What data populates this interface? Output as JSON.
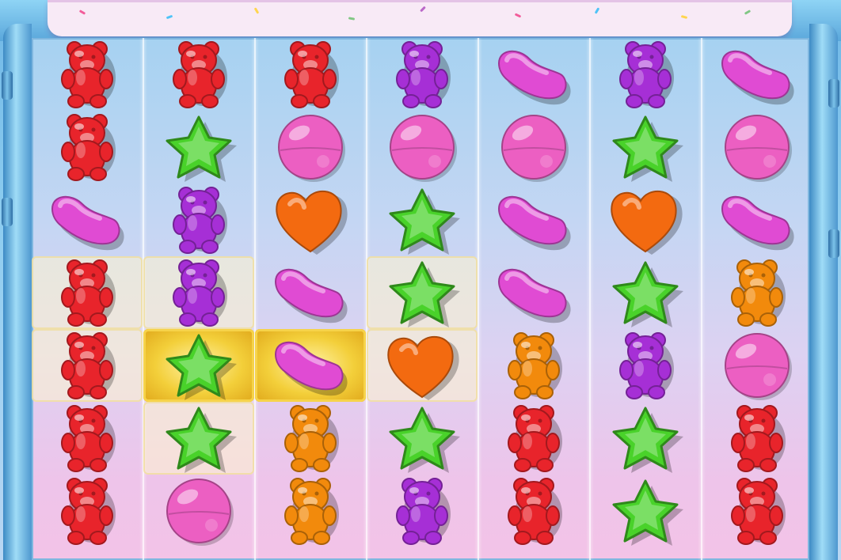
{
  "game": {
    "grid": [
      [
        "red-bear",
        "red-bear",
        "red-bear",
        "purple-bear",
        "pink-bean",
        "purple-bear",
        "pink-bean"
      ],
      [
        "red-bear",
        "green-star",
        "pink-lollipop",
        "pink-lollipop",
        "pink-lollipop",
        "green-star",
        "pink-lollipop"
      ],
      [
        "pink-bean",
        "purple-bear",
        "orange-heart",
        "green-star",
        "pink-bean",
        "orange-heart",
        "pink-bean"
      ],
      [
        "red-bear",
        "purple-bear",
        "pink-bean",
        "green-star",
        "pink-bean",
        "green-star",
        "orange-bear"
      ],
      [
        "red-bear",
        "green-star",
        "pink-bean",
        "orange-heart",
        "orange-bear",
        "purple-bear",
        "pink-lollipop"
      ],
      [
        "red-bear",
        "green-star",
        "orange-bear",
        "green-star",
        "red-bear",
        "green-star",
        "red-bear"
      ],
      [
        "red-bear",
        "pink-lollipop",
        "orange-bear",
        "purple-bear",
        "red-bear",
        "green-star",
        "red-bear"
      ]
    ],
    "highlights": [
      [
        "none",
        "none",
        "none",
        "none",
        "none",
        "none",
        "none"
      ],
      [
        "none",
        "none",
        "none",
        "none",
        "none",
        "none",
        "none"
      ],
      [
        "none",
        "none",
        "none",
        "none",
        "none",
        "none",
        "none"
      ],
      [
        "soft",
        "soft",
        "none",
        "soft",
        "none",
        "none",
        "none"
      ],
      [
        "soft",
        "gold",
        "gold",
        "soft",
        "none",
        "none",
        "none"
      ],
      [
        "none",
        "soft",
        "none",
        "none",
        "none",
        "none",
        "none"
      ],
      [
        "none",
        "none",
        "none",
        "none",
        "none",
        "none",
        "none"
      ]
    ]
  },
  "symbol_colors": {
    "red-bear": "#e8242b",
    "purple-bear": "#a62fd6",
    "orange-bear": "#f28a0c",
    "green-star": "#49d22a",
    "pink-bean": "#e04bd3",
    "pink-lollipop": "#ec5fc2",
    "orange-heart": "#f36a10"
  }
}
